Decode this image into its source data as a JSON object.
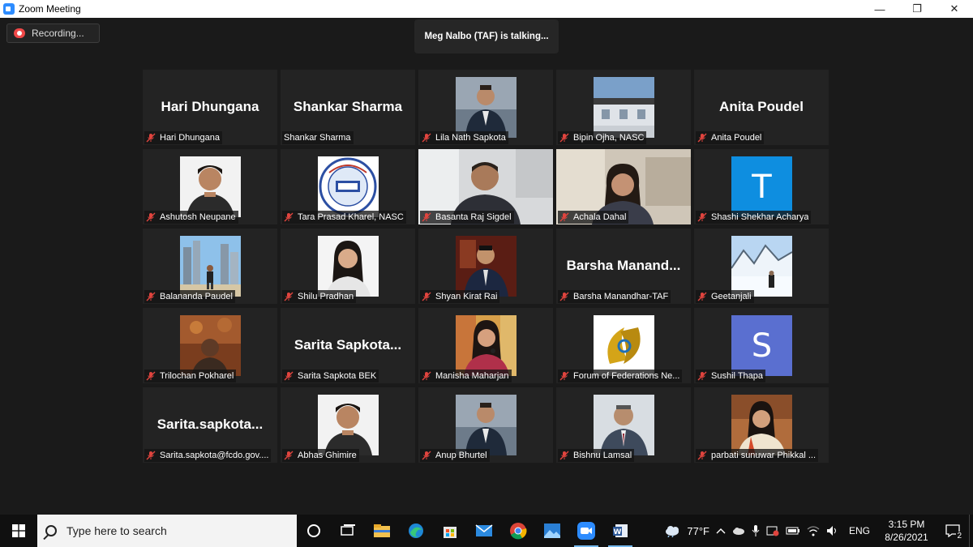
{
  "window": {
    "title": "Zoom Meeting",
    "controls": {
      "minimize": "—",
      "restore": "❐",
      "close": "✕"
    }
  },
  "meeting": {
    "recording_label": "Recording...",
    "talking_banner": "Meg Nalbo (TAF) is talking...",
    "participants": [
      {
        "label": "Hari Dhungana",
        "display": "Hari Dhungana",
        "kind": "name"
      },
      {
        "label": "Shankar Sharma",
        "display": "Shankar Sharma",
        "kind": "name",
        "unmuted": true
      },
      {
        "label": "Lila Nath Sapkota",
        "kind": "photo",
        "art": "suit"
      },
      {
        "label": "Bipin Ojha, NASC",
        "kind": "photo",
        "art": "building"
      },
      {
        "label": "Anita Poudel",
        "display": "Anita Poudel",
        "kind": "name"
      },
      {
        "label": "Ashutosh Neupane",
        "kind": "photo",
        "art": "portrait-light"
      },
      {
        "label": "Tara Prasad Kharel, NASC",
        "kind": "photo",
        "art": "logo"
      },
      {
        "label": "Basanta Raj Sigdel",
        "kind": "video",
        "art": "office-man"
      },
      {
        "label": "Achala Dahal",
        "kind": "video",
        "art": "woman-room"
      },
      {
        "label": "Shashi Shekhar Acharya",
        "kind": "letter",
        "letter": "T",
        "color": "#0e8ee0"
      },
      {
        "label": "Balananda Paudel",
        "kind": "photo",
        "art": "city"
      },
      {
        "label": "Shilu Pradhan",
        "kind": "photo",
        "art": "portrait-woman"
      },
      {
        "label": "Shyan Kirat Rai",
        "kind": "photo",
        "art": "suit-dark"
      },
      {
        "label": "Barsha Manandhar-TAF",
        "display": "Barsha  Manand...",
        "kind": "name"
      },
      {
        "label": "Geetanjali",
        "kind": "photo",
        "art": "snow"
      },
      {
        "label": "Trilochan Pokharel",
        "kind": "photo",
        "art": "warm"
      },
      {
        "label": "Sarita Sapkota BEK",
        "display": "Sarita  Sapkota...",
        "kind": "name"
      },
      {
        "label": "Manisha Maharjan",
        "kind": "photo",
        "art": "woman-mic"
      },
      {
        "label": "Forum of Federations Ne...",
        "kind": "photo",
        "art": "forum-logo"
      },
      {
        "label": "Sushil Thapa",
        "kind": "letter",
        "letter": "S",
        "color": "#5a6fd0"
      },
      {
        "label": "Sarita.sapkota@fcdo.gov....",
        "display": "Sarita.sapkota...",
        "kind": "name"
      },
      {
        "label": "Abhas Ghimire",
        "kind": "photo",
        "art": "portrait-light"
      },
      {
        "label": "Anup Bhurtel",
        "kind": "photo",
        "art": "suit"
      },
      {
        "label": "Bishnu Lamsal",
        "kind": "photo",
        "art": "suit-grey"
      },
      {
        "label": "parbati sunuwar Phikkal ...",
        "kind": "photo",
        "art": "woman-warm"
      }
    ]
  },
  "taskbar": {
    "search_placeholder": "Type here to search",
    "apps": [
      "task-view",
      "file-explorer",
      "edge",
      "store",
      "mail",
      "chrome",
      "photos",
      "zoom",
      "word"
    ],
    "weather": "77°F",
    "language": "ENG",
    "time": "3:15 PM",
    "date": "8/26/2021",
    "notifications": "2"
  },
  "colors": {
    "muted_mic": "#e0443e",
    "accent": "#76b9ed"
  }
}
